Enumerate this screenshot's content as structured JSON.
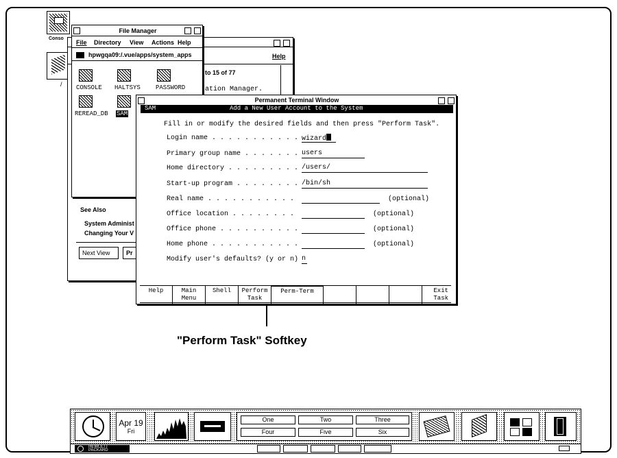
{
  "file_manager": {
    "title": "File Manager",
    "menu": [
      "File",
      "Directory",
      "View",
      "Actions",
      "Help"
    ],
    "path": "hpwgqa09:/.vue/apps/system_apps",
    "files": [
      "CONSOLE",
      "HALTSYS",
      "PASSWORD",
      "REREAD_DB",
      "SAM"
    ]
  },
  "help_window": {
    "menu_help": "Help",
    "page_range": "to 15 of 77",
    "line_partial": "ation Manager.",
    "see_also": "See Also",
    "link1": "System Administ",
    "link2": "Changing Your V",
    "next_view": "Next View",
    "btn2": "Pr"
  },
  "console_label": "Conso",
  "terminal": {
    "title": "Permanent Terminal Window",
    "sam_label": "SAM",
    "header": "Add a New User Account to the System",
    "instruction": "Fill in or modify the desired fields and then press \"Perform Task\".",
    "fields": [
      {
        "label": "Login name . . . . . . . . . . .",
        "value": "wizard",
        "optional": ""
      },
      {
        "label": "Primary group name . . . . . . .",
        "value": "users",
        "optional": ""
      },
      {
        "label": "Home directory . . . . . . . . .",
        "value": "/users/",
        "optional": ""
      },
      {
        "label": "Start-up program . . . . . . . .",
        "value": "/bin/sh",
        "optional": ""
      },
      {
        "label": "Real name . . . . . . . . . . .",
        "value": "",
        "optional": "(optional)"
      },
      {
        "label": "Office location . . . . . . . .",
        "value": "",
        "optional": "(optional)"
      },
      {
        "label": "Office phone . . . . . . . . . .",
        "value": "",
        "optional": "(optional)"
      },
      {
        "label": "Home phone . . . . . . . . . . .",
        "value": "",
        "optional": "(optional)"
      }
    ],
    "modify_label": "Modify user's defaults? (y or n)",
    "modify_value": "n",
    "softkeys": [
      {
        "l1": "Help",
        "l2": ""
      },
      {
        "l1": "Main",
        "l2": "Menu"
      },
      {
        "l1": "Shell",
        "l2": ""
      },
      {
        "l1": "Perform",
        "l2": "Task"
      },
      {
        "l1": "Perm-Term",
        "l2": ""
      },
      {
        "l1": "",
        "l2": ""
      },
      {
        "l1": "",
        "l2": ""
      },
      {
        "l1": "",
        "l2": ""
      },
      {
        "l1": "Exit",
        "l2": "Task"
      }
    ]
  },
  "callout": "\"Perform Task\" Softkey",
  "front_panel": {
    "date_month": "Apr 19",
    "date_day": "Fri",
    "workspaces": [
      "One",
      "Two",
      "Three",
      "Four",
      "Five",
      "Six"
    ],
    "brand1": "HEWLETT",
    "brand2": "PACKARD"
  }
}
